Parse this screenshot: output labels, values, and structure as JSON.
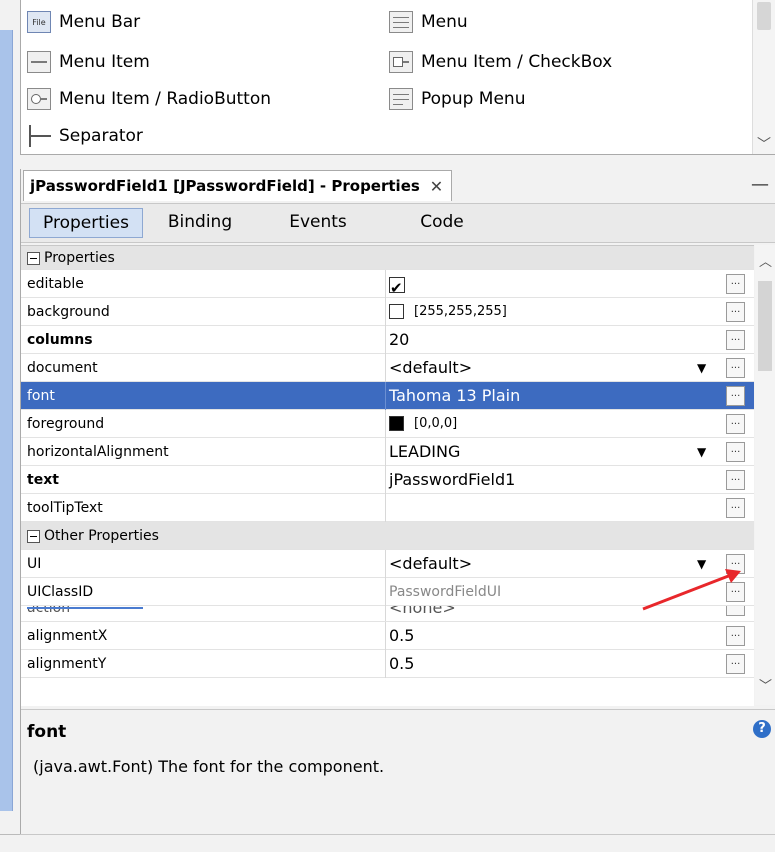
{
  "palette": {
    "items": [
      {
        "label": "Menu Bar",
        "icon": "file-menubar-icon",
        "icon_text": "File"
      },
      {
        "label": "Menu",
        "icon": "menu-icon"
      },
      {
        "label": "Menu Item",
        "icon": "menu-item-icon"
      },
      {
        "label": "Menu Item / CheckBox",
        "icon": "menu-item-checkbox-icon"
      },
      {
        "label": "Menu Item / RadioButton",
        "icon": "menu-item-radiobutton-icon"
      },
      {
        "label": "Popup Menu",
        "icon": "popup-menu-icon"
      },
      {
        "label": "Separator",
        "icon": "separator-icon"
      }
    ]
  },
  "window": {
    "title": "jPasswordField1 [JPasswordField] - Properties",
    "close_glyph": "✕",
    "minimize_glyph": "—"
  },
  "tabs": [
    "Properties",
    "Binding",
    "Events",
    "Code"
  ],
  "sheet": {
    "category1": "Properties",
    "category2": "Other Properties",
    "rows": [
      {
        "name": "editable",
        "value": "",
        "checked": true
      },
      {
        "name": "background",
        "value": "[255,255,255]",
        "swatch": "#ffffff"
      },
      {
        "name": "columns",
        "value": "20",
        "bold": true
      },
      {
        "name": "document",
        "value": "<default>",
        "dropdown": true
      },
      {
        "name": "font",
        "value": "Tahoma 13 Plain",
        "selected": true
      },
      {
        "name": "foreground",
        "value": "[0,0,0]",
        "swatch": "#000000"
      },
      {
        "name": "horizontalAlignment",
        "value": "LEADING",
        "dropdown": true
      },
      {
        "name": "text",
        "value": "jPasswordField1",
        "bold": true
      },
      {
        "name": "toolTipText",
        "value": ""
      },
      {
        "name": "UI",
        "value": "<default>",
        "dropdown": true
      },
      {
        "name": "UIClassID",
        "value": "PasswordFieldUI",
        "gray": true
      },
      {
        "name": "action",
        "value": "<none>"
      },
      {
        "name": "alignmentX",
        "value": "0.5"
      },
      {
        "name": "alignmentY",
        "value": "0.5"
      }
    ],
    "ellipsis": "...",
    "dropdown_glyph": "▼"
  },
  "description": {
    "title": "font",
    "text": "(java.awt.Font) The font for the component.",
    "help_glyph": "?"
  },
  "colors": {
    "selection": "#3d6bc0",
    "active_tab": "#d3e1f4",
    "arrow": "#e8272b",
    "help": "#2f6fc8"
  }
}
